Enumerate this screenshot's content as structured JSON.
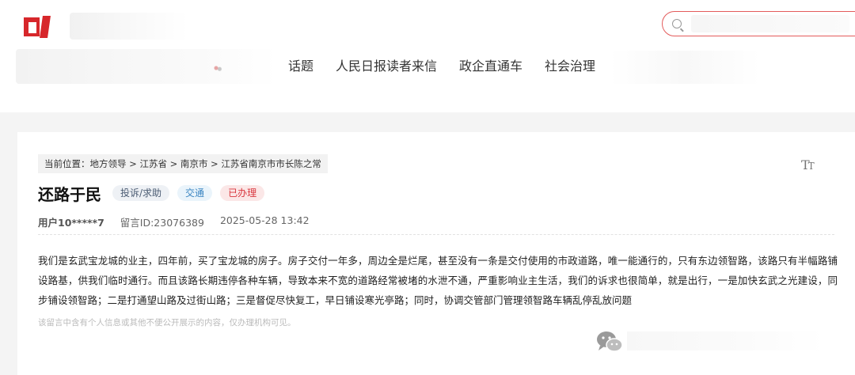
{
  "header": {
    "search": {
      "placeholder": ""
    },
    "nav": [
      "话题",
      "人民日报读者来信",
      "政企直通车",
      "社会治理"
    ]
  },
  "breadcrumb": {
    "prefix": "当前位置：",
    "items": [
      "地方领导",
      "江苏省",
      "南京市",
      "江苏省南京市市长陈之常"
    ],
    "separator": " > "
  },
  "font_size_toggle": "TT",
  "message": {
    "title": "还路于民",
    "tags": {
      "type": "投诉/求助",
      "field": "交通",
      "status": "已办理"
    },
    "user": "用户10*****7",
    "message_id": "留言ID:23076389",
    "datetime": "2025-05-28 13:42",
    "body": "我们是玄武宝龙城的业主，四年前，买了宝龙城的房子。房子交付一年多，周边全是烂尾，甚至没有一条是交付使用的市政道路，唯一能通行的，只有东边领智路，该路只有半幅路铺设路基，供我们临时通行。而且该路长期违停各种车辆，导致本来不宽的道路经常被堵的水泄不通，严重影响业主生活，我们的诉求也很简单，就是出行，一是加快玄武之光建设，同步铺设领智路；二是打通望山路及过街山路；三是督促尽快复工，早日铺设寒光亭路；同时，协调交管部门管理领智路车辆乱停乱放问题",
    "notice": "该留言中含有个人信息或其他不便公开展示的内容，仅办理机构可见。"
  },
  "colors": {
    "brand_red": "#d7272b",
    "status_red": "#d9363e",
    "field_blue": "#3c86c2"
  }
}
